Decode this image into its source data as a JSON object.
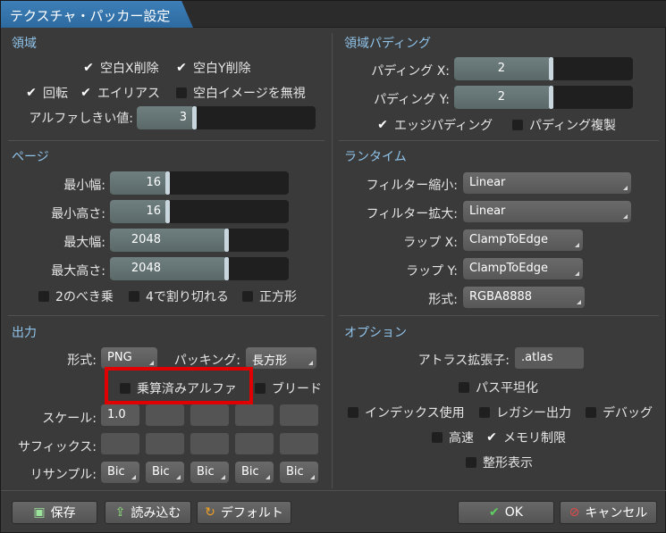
{
  "window": {
    "title": "テクスチャ・パッカー設定"
  },
  "region": {
    "title": "領域",
    "strip_x": {
      "label": "空白X削除",
      "checked": true
    },
    "strip_y": {
      "label": "空白Y削除",
      "checked": true
    },
    "rotation": {
      "label": "回転",
      "checked": true
    },
    "alias": {
      "label": "エイリアス",
      "checked": true
    },
    "ignore_blank": {
      "label": "空白イメージを無視",
      "checked": false
    },
    "alpha_threshold": {
      "label": "アルファしきい値:",
      "value": "3",
      "fraction": 0.03
    }
  },
  "region_padding": {
    "title": "領域パディング",
    "padding_x": {
      "label": "パディング X:",
      "value": "2",
      "fraction": 0.2
    },
    "padding_y": {
      "label": "パディング Y:",
      "value": "2",
      "fraction": 0.2
    },
    "edge_padding": {
      "label": "エッジパディング",
      "checked": true
    },
    "duplicate_padding": {
      "label": "パディング複製",
      "checked": false
    }
  },
  "page": {
    "title": "ページ",
    "min_width": {
      "label": "最小幅:",
      "value": "16",
      "fraction": 0.0
    },
    "min_height": {
      "label": "最小高さ:",
      "value": "16",
      "fraction": 0.0
    },
    "max_width": {
      "label": "最大幅:",
      "value": "2048",
      "fraction": 0.5
    },
    "max_height": {
      "label": "最大高さ:",
      "value": "2048",
      "fraction": 0.5
    },
    "pot": {
      "label": "2のべき乗",
      "checked": false
    },
    "multiple_of_four": {
      "label": "4で割り切れる",
      "checked": false
    },
    "square": {
      "label": "正方形",
      "checked": false
    }
  },
  "runtime": {
    "title": "ランタイム",
    "filter_min": {
      "label": "フィルター縮小:",
      "value": "Linear"
    },
    "filter_mag": {
      "label": "フィルター拡大:",
      "value": "Linear"
    },
    "wrap_x": {
      "label": "ラップ X:",
      "value": "ClampToEdge"
    },
    "wrap_y": {
      "label": "ラップ Y:",
      "value": "ClampToEdge"
    },
    "format": {
      "label": "形式:",
      "value": "RGBA8888"
    }
  },
  "output": {
    "title": "出力",
    "format_label": "形式:",
    "format_value": "PNG",
    "packing_label": "パッキング:",
    "packing_value": "長方形",
    "premultiply": {
      "label": "乗算済みアルファ",
      "checked": false
    },
    "bleed": {
      "label": "ブリード",
      "checked": false
    },
    "scale_label": "スケール:",
    "scale_values": [
      "1.0",
      "",
      "",
      "",
      ""
    ],
    "suffix_label": "サフィックス:",
    "resample_label": "リサンプル:",
    "resample_values": [
      "Bic",
      "Bic",
      "Bic",
      "Bic",
      "Bic"
    ]
  },
  "options": {
    "title": "オプション",
    "atlas_ext": {
      "label": "アトラス拡張子:",
      "value": ".atlas"
    },
    "flatten_paths": {
      "label": "パス平坦化",
      "checked": false
    },
    "use_indexes": {
      "label": "インデックス使用",
      "checked": false
    },
    "legacy_output": {
      "label": "レガシー出力",
      "checked": false
    },
    "debug": {
      "label": "デバッグ",
      "checked": false
    },
    "fast": {
      "label": "高速",
      "checked": false
    },
    "limit_memory": {
      "label": "メモリ制限",
      "checked": true
    },
    "pretty_print": {
      "label": "整形表示",
      "checked": false
    }
  },
  "footer": {
    "save": "保存",
    "load": "読み込む",
    "default": "デフォルト",
    "ok": "OK",
    "cancel": "キャンセル"
  },
  "colors": {
    "accent": "#8fc3ea",
    "title_tab": "#2d6aa0",
    "highlight": "#e00000"
  }
}
